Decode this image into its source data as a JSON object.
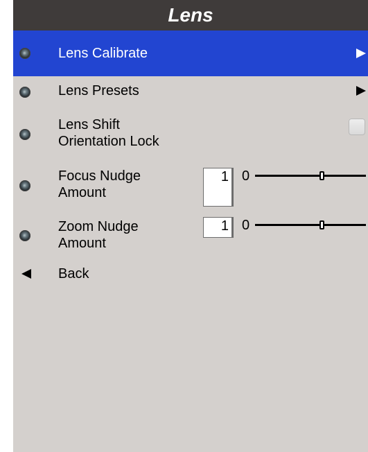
{
  "title": "Lens",
  "menu": [
    {
      "label": "Lens Calibrate",
      "control": "submenu"
    },
    {
      "label": "Lens Presets",
      "control": "submenu"
    },
    {
      "label": "Lens Shift\nOrientation Lock",
      "control": "checkbox",
      "checked": false
    },
    {
      "label": "Focus Nudge\nAmount",
      "control": "numeric",
      "value": "1",
      "slider_min": "0",
      "slider_fraction": 0.6
    },
    {
      "label": "Zoom Nudge\nAmount",
      "control": "numeric",
      "value": "1",
      "slider_min": "0",
      "slider_fraction": 0.6
    }
  ],
  "back_label": "Back",
  "colors": {
    "title_bar": "#3f3b3a",
    "selected_row": "#2245d1",
    "panel_bg": "#d4d0cd"
  }
}
